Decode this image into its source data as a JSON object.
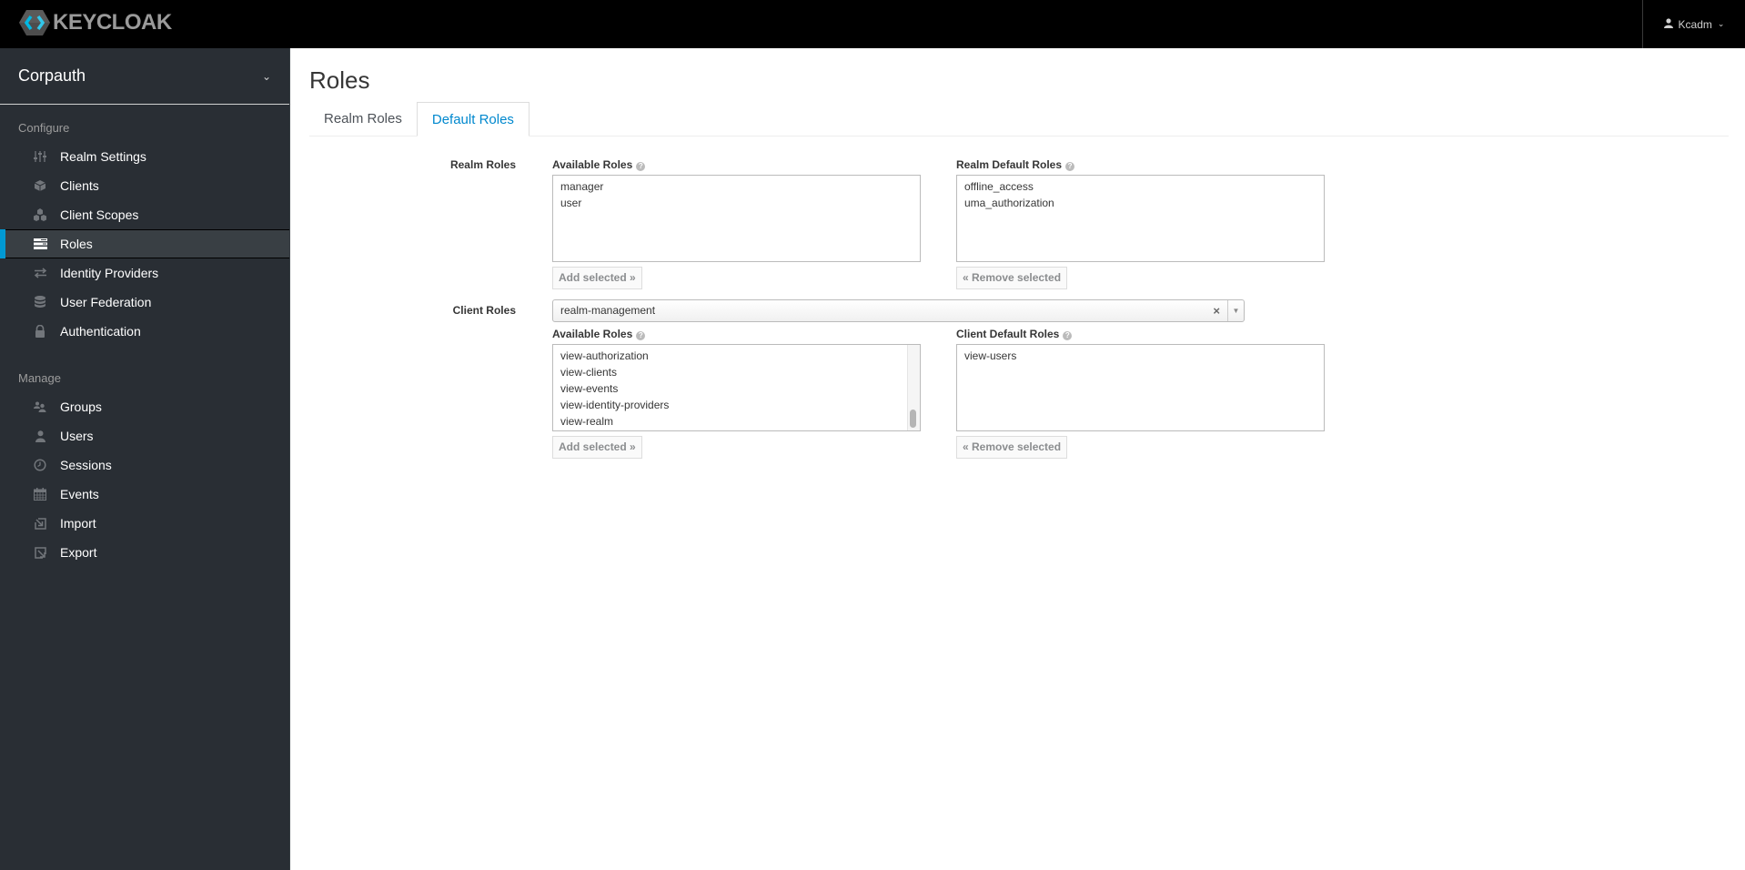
{
  "header": {
    "brand": "KEYCLOAK",
    "user": "Kcadm"
  },
  "sidebar": {
    "realm": "Corpauth",
    "sections": [
      {
        "title": "Configure",
        "items": [
          {
            "label": "Realm Settings",
            "icon": "sliders-icon"
          },
          {
            "label": "Clients",
            "icon": "cube-icon"
          },
          {
            "label": "Client Scopes",
            "icon": "cubes-icon"
          },
          {
            "label": "Roles",
            "icon": "roles-icon",
            "active": true
          },
          {
            "label": "Identity Providers",
            "icon": "exchange-icon"
          },
          {
            "label": "User Federation",
            "icon": "database-icon"
          },
          {
            "label": "Authentication",
            "icon": "lock-icon"
          }
        ]
      },
      {
        "title": "Manage",
        "items": [
          {
            "label": "Groups",
            "icon": "users-icon"
          },
          {
            "label": "Users",
            "icon": "user-icon"
          },
          {
            "label": "Sessions",
            "icon": "clock-icon"
          },
          {
            "label": "Events",
            "icon": "calendar-icon"
          },
          {
            "label": "Import",
            "icon": "import-icon"
          },
          {
            "label": "Export",
            "icon": "export-icon"
          }
        ]
      }
    ]
  },
  "main": {
    "title": "Roles",
    "tabs": [
      {
        "label": "Realm Roles",
        "active": false
      },
      {
        "label": "Default Roles",
        "active": true
      }
    ],
    "realm_roles": {
      "label": "Realm Roles",
      "available_label": "Available Roles",
      "available": [
        "manager",
        "user"
      ],
      "add_button": "Add selected »",
      "default_label": "Realm Default Roles",
      "defaults": [
        "offline_access",
        "uma_authorization"
      ],
      "remove_button": "« Remove selected"
    },
    "client_roles": {
      "label": "Client Roles",
      "client_selected": "realm-management",
      "clear_symbol": "×",
      "available_label": "Available Roles",
      "available": [
        "view-authorization",
        "view-clients",
        "view-events",
        "view-identity-providers",
        "view-realm"
      ],
      "add_button": "Add selected »",
      "default_label": "Client Default Roles",
      "defaults": [
        "view-users"
      ],
      "remove_button": "« Remove selected"
    }
  }
}
